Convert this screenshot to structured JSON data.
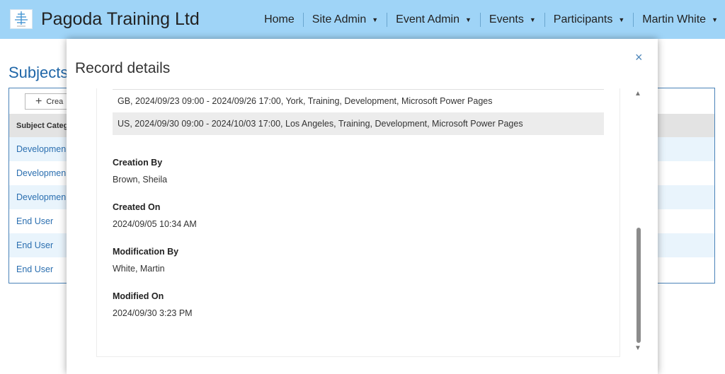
{
  "header": {
    "brand": "Pagoda Training Ltd",
    "nav": [
      {
        "label": "Home",
        "has_caret": false
      },
      {
        "label": "Site Admin",
        "has_caret": true
      },
      {
        "label": "Event Admin",
        "has_caret": true
      },
      {
        "label": "Events",
        "has_caret": true
      },
      {
        "label": "Participants",
        "has_caret": true
      },
      {
        "label": "Martin White",
        "has_caret": true
      }
    ],
    "bg_color": "#9fd4f7"
  },
  "background_page": {
    "title": "Subjects",
    "create_label": "Crea",
    "column_header": "Subject Catego",
    "rows": [
      "Developmen",
      "Developmen",
      "Developmen",
      "End User",
      "End User",
      "End User"
    ],
    "link_color": "#2b6fb0"
  },
  "modal": {
    "title": "Record details",
    "close_icon": "×",
    "events": [
      "GB, 2024/09/23 09:00 - 2024/09/26 17:00, York, Training, Development, Microsoft Power Pages",
      "US, 2024/09/30 09:00 - 2024/10/03 17:00, Los Angeles, Training, Development, Microsoft Power Pages"
    ],
    "fields": [
      {
        "label": "Creation By",
        "value": "Brown, Sheila"
      },
      {
        "label": "Created On",
        "value": "2024/09/05 10:34 AM"
      },
      {
        "label": "Modification By",
        "value": "White, Martin"
      },
      {
        "label": "Modified On",
        "value": "2024/09/30 3:23 PM"
      }
    ],
    "scroll_up": "▲",
    "scroll_down": "▼"
  }
}
